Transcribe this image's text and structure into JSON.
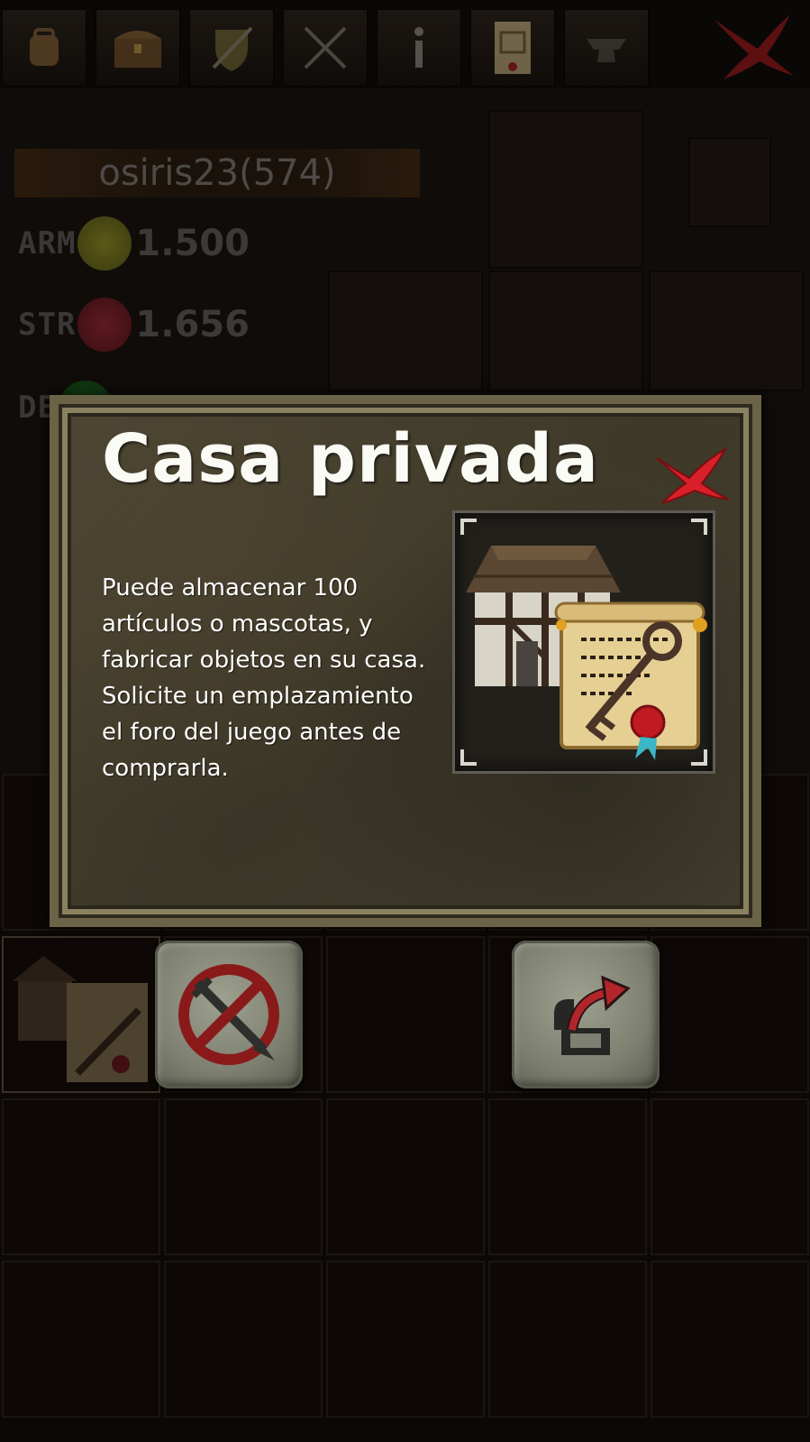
{
  "toolbar": {
    "tabs": [
      {
        "icon": "backpack-icon"
      },
      {
        "icon": "chest-icon"
      },
      {
        "icon": "shield-sword-icon"
      },
      {
        "icon": "crossed-swords-icon"
      },
      {
        "icon": "info-icon"
      },
      {
        "icon": "scroll-icon"
      },
      {
        "icon": "anvil-icon"
      }
    ],
    "close_icon": "close-x-icon"
  },
  "character": {
    "name": "osiris23(574)",
    "stats": [
      {
        "label": "ARM",
        "value": "1.500",
        "icon": "armor-icon",
        "color": "#c9c41e"
      },
      {
        "label": "STR",
        "value": "1.656",
        "icon": "strength-icon",
        "color": "#c2283a"
      },
      {
        "label": "DE",
        "value": "",
        "icon": "dexterity-icon",
        "color": "#1f8f2a"
      }
    ]
  },
  "modal": {
    "title": "Casa privada",
    "description": "Puede almacenar 100 artículos o mascotas, y fabricar objetos en su casa. Solicite un emplazamiento el foro del juego antes de comprarla.",
    "item_image": "house-key-deed-icon",
    "close_icon": "close-x-icon"
  },
  "actions": {
    "unequip_icon": "no-sword-icon",
    "move_icon": "move-to-icon"
  },
  "colors": {
    "close_red": "#d8202a",
    "panel_stone": "#4a4433",
    "text": "#ffffff"
  }
}
